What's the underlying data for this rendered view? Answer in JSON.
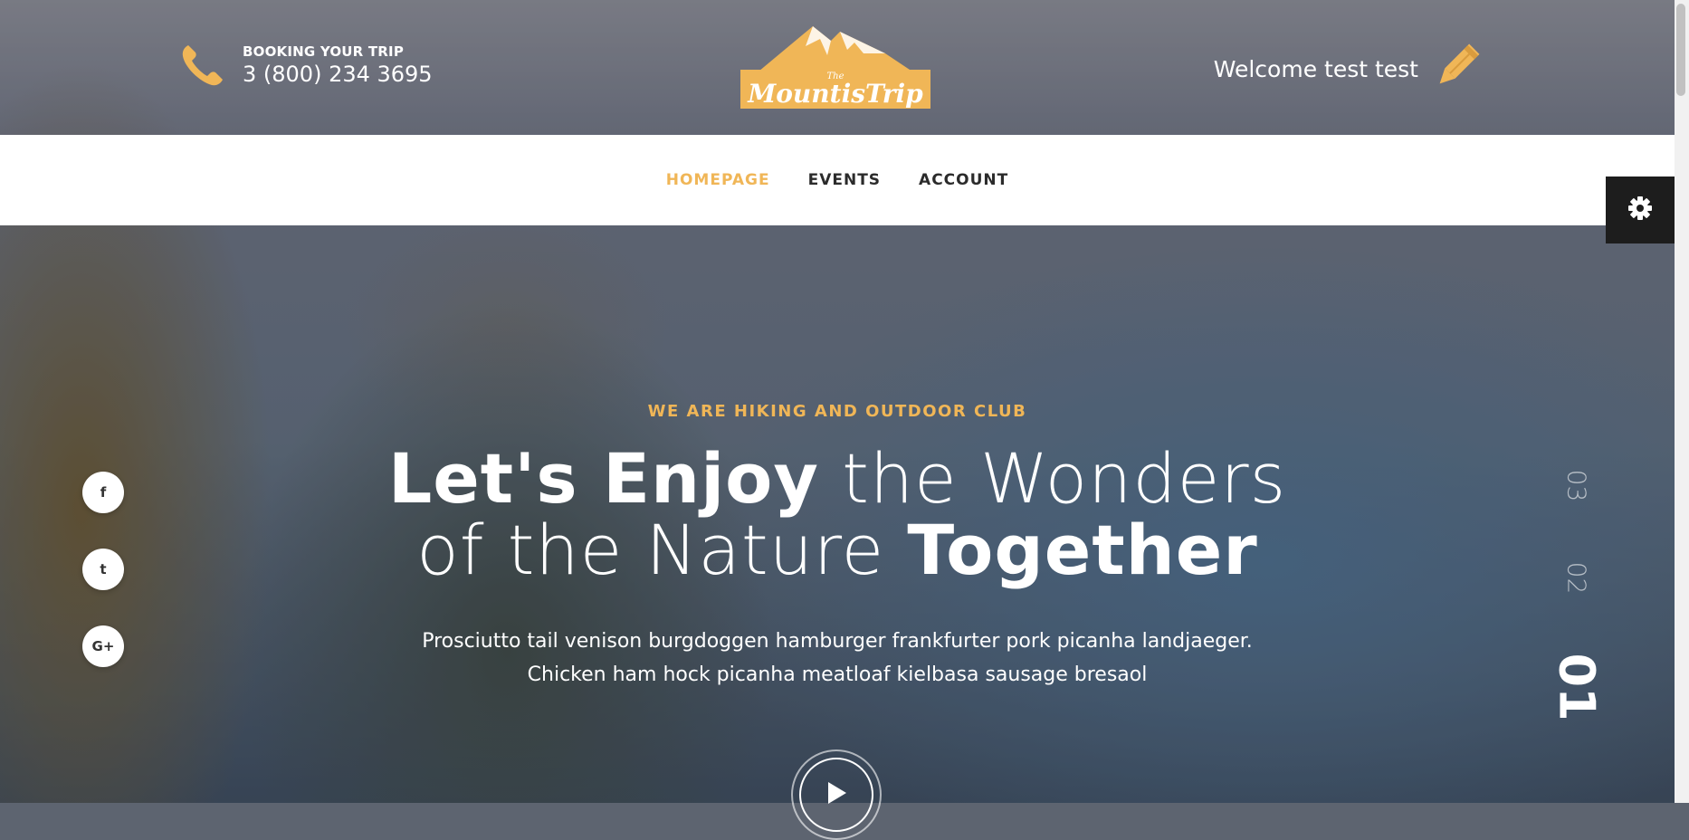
{
  "header": {
    "booking_label": "BOOKING YOUR TRIP",
    "phone": "3 (800) 234 3695",
    "logo_small": "The",
    "logo_name": "MountisTrip",
    "welcome": "Welcome test test"
  },
  "nav": {
    "items": [
      {
        "label": "HOMEPAGE",
        "active": true
      },
      {
        "label": "EVENTS",
        "active": false
      },
      {
        "label": "ACCOUNT",
        "active": false
      }
    ]
  },
  "social": {
    "items": [
      {
        "name": "facebook-icon",
        "glyph": "f"
      },
      {
        "name": "twitter-icon",
        "glyph": "t"
      },
      {
        "name": "google-plus-icon",
        "glyph": "G+"
      }
    ]
  },
  "hero": {
    "eyebrow": "WE ARE HIKING AND OUTDOOR CLUB",
    "headline_line1_bold": "Let's Enjoy",
    "headline_line1_light": "the Wonders",
    "headline_line2_light": "of the Nature",
    "headline_line2_bold": "Together",
    "subtext_line1": "Prosciutto tail venison burgdoggen hamburger frankfurter pork picanha landjaeger.",
    "subtext_line2": "Chicken ham hock picanha meatloaf kielbasa sausage bresaol"
  },
  "slides": {
    "numbers": [
      "03",
      "02",
      "01"
    ],
    "active": "01"
  },
  "colors": {
    "accent": "#f0b657",
    "nav_text": "#2b2b2b",
    "settings_bg": "#1d1d1d"
  },
  "icons": {
    "phone": "phone-icon",
    "edit": "pencil-icon",
    "settings": "gear-icon",
    "play": "play-icon"
  }
}
